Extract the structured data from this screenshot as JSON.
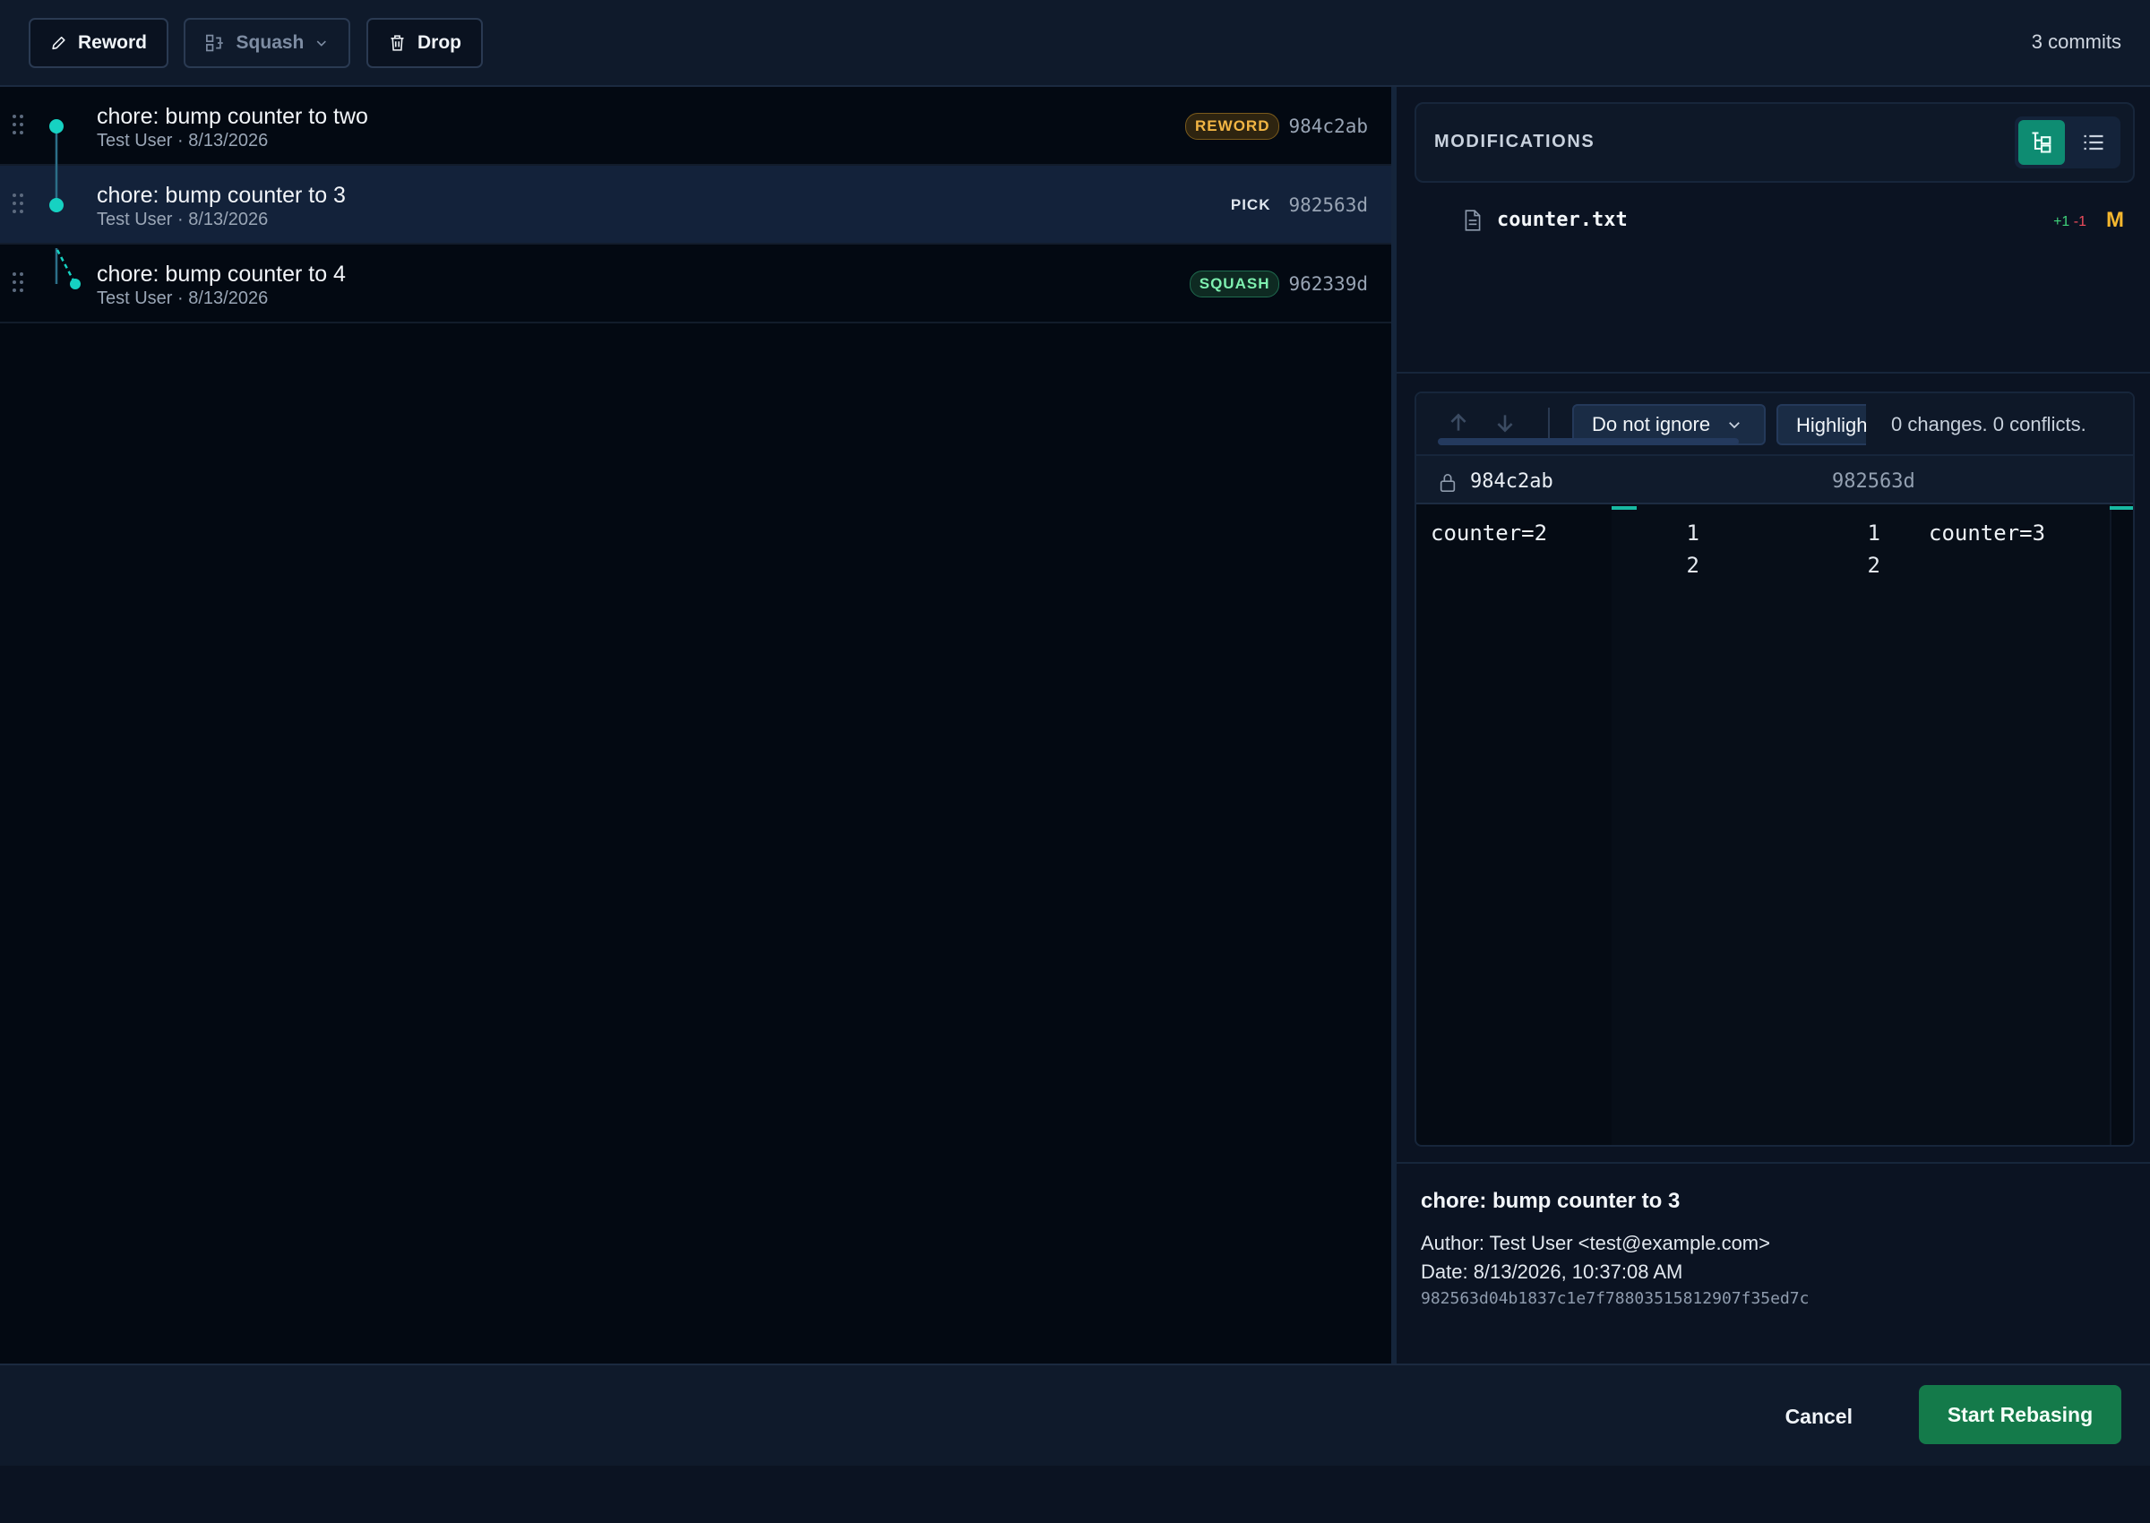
{
  "toolbar": {
    "reword_label": "Reword",
    "squash_label": "Squash",
    "drop_label": "Drop",
    "commit_count": "3 commits"
  },
  "commits": [
    {
      "title": "chore: bump counter to two",
      "meta": "Test User · 8/13/2026",
      "action": "REWORD",
      "sha": "984c2ab"
    },
    {
      "title": "chore: bump counter to 3",
      "meta": "Test User · 8/13/2026",
      "action": "PICK",
      "sha": "982563d"
    },
    {
      "title": "chore: bump counter to 4",
      "meta": "Test User · 8/13/2026",
      "action": "SQUASH",
      "sha": "962339d"
    }
  ],
  "modifications": {
    "title": "MODIFICATIONS",
    "files": [
      {
        "name": "counter.txt",
        "added": "+1",
        "removed": "-1",
        "status": "M"
      }
    ]
  },
  "diff": {
    "whitespace_option": "Do not ignore",
    "highlight_label": "Highlight",
    "summary": "0 changes. 0 conflicts.",
    "left_sha": "984c2ab",
    "right_sha": "982563d",
    "left_lines": [
      "counter=2"
    ],
    "right_lines": [
      "counter=3"
    ],
    "left_numbers": [
      "1",
      "2"
    ],
    "right_numbers": [
      "1",
      "2"
    ]
  },
  "details": {
    "title": "chore: bump counter to 3",
    "author": "Author: Test User <test@example.com>",
    "date": "Date: 8/13/2026, 10:37:08 AM",
    "hash": "982563d04b1837c1e7f78803515812907f35ed7c"
  },
  "footer": {
    "cancel_label": "Cancel",
    "start_label": "Start Rebasing"
  },
  "colors": {
    "accent": "#0e8c72",
    "graph_node": "#16d2c2",
    "primary_button": "#147a4a",
    "reword_badge": "#f2b544",
    "squash_badge": "#7ef0b0",
    "modified_status": "#f5b72e"
  },
  "icons": {
    "reword": "pencil-icon",
    "squash": "squash-icon",
    "drop": "trash-icon",
    "file": "file-icon",
    "lock": "lock-icon",
    "tree_view": "tree-view-icon",
    "list_view": "list-view-icon"
  }
}
